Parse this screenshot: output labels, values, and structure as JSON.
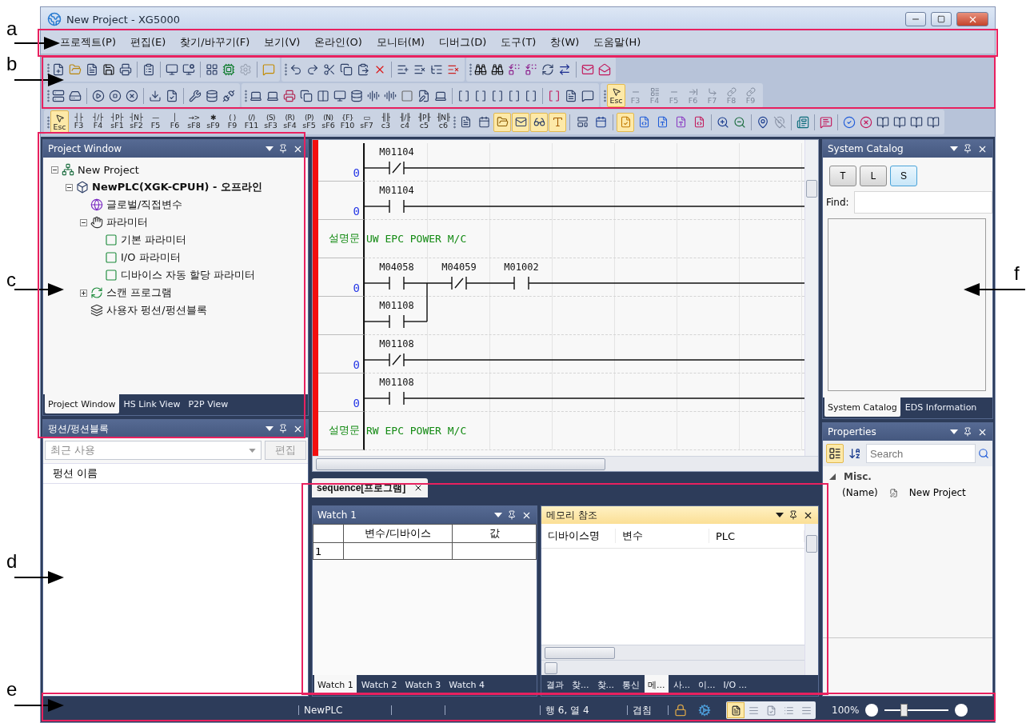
{
  "annotations": [
    {
      "label": "a"
    },
    {
      "label": "b"
    },
    {
      "label": "c"
    },
    {
      "label": "d"
    },
    {
      "label": "e"
    },
    {
      "label": "f"
    }
  ],
  "window": {
    "title": "New Project - XG5000"
  },
  "menu": [
    "프로젝트(P)",
    "편집(E)",
    "찾기/바꾸기(F)",
    "보기(V)",
    "온라인(O)",
    "모니터(M)",
    "디버그(D)",
    "도구(T)",
    "창(W)",
    "도움말(H)"
  ],
  "toolbar": {
    "edit_keys": [
      {
        "label": "Esc",
        "selected": true
      },
      {
        "label": "F3",
        "selected": false
      },
      {
        "label": "F4",
        "selected": false
      },
      {
        "label": "F5",
        "selected": false
      },
      {
        "label": "F6",
        "selected": false
      },
      {
        "label": "F7",
        "selected": false
      },
      {
        "label": "F8",
        "selected": false
      },
      {
        "label": "F9",
        "selected": false
      }
    ],
    "ladder_keys": [
      {
        "kind": "pointer",
        "label": "Esc",
        "selected": true
      },
      {
        "kind": "symbol",
        "symbol": "┤├",
        "label": "F3",
        "selected": false
      },
      {
        "kind": "symbol",
        "symbol": "┤/├",
        "label": "F4",
        "selected": false
      },
      {
        "kind": "symbol",
        "symbol": "┤P├",
        "label": "sF1",
        "selected": false
      },
      {
        "kind": "symbol",
        "symbol": "┤N├",
        "label": "sF2",
        "selected": false
      },
      {
        "kind": "symbol",
        "symbol": "—",
        "label": "F5",
        "selected": false
      },
      {
        "kind": "symbol",
        "symbol": "│",
        "label": "F6",
        "selected": false
      },
      {
        "kind": "symbol",
        "symbol": "→>",
        "label": "sF8",
        "selected": false
      },
      {
        "kind": "symbol",
        "symbol": "✱",
        "label": "sF9",
        "selected": false
      },
      {
        "kind": "symbol",
        "symbol": "( )",
        "label": "F9",
        "selected": false
      },
      {
        "kind": "symbol",
        "symbol": "(/)",
        "label": "F11",
        "selected": false
      },
      {
        "kind": "symbol",
        "symbol": "(S)",
        "label": "sF3",
        "selected": false
      },
      {
        "kind": "symbol",
        "symbol": "(R)",
        "label": "sF4",
        "selected": false
      },
      {
        "kind": "symbol",
        "symbol": "(P)",
        "label": "sF5",
        "selected": false
      },
      {
        "kind": "symbol",
        "symbol": "(N)",
        "label": "sF6",
        "selected": false
      },
      {
        "kind": "symbol",
        "symbol": "{F}",
        "label": "F10",
        "selected": false
      },
      {
        "kind": "symbol",
        "symbol": "▭",
        "label": "sF7",
        "selected": false
      },
      {
        "kind": "symbol",
        "symbol": "╢╟",
        "label": "c3",
        "selected": false
      },
      {
        "kind": "symbol",
        "symbol": "╢/╟",
        "label": "c4",
        "selected": false
      },
      {
        "kind": "symbol",
        "symbol": "╢P╟",
        "label": "c5",
        "selected": false
      },
      {
        "kind": "symbol",
        "symbol": "╢N╟",
        "label": "c6",
        "selected": false
      }
    ],
    "toggle_groups": [
      [
        {
          "selected": false
        },
        {
          "selected": false
        },
        {
          "selected": true
        },
        {
          "selected": true
        },
        {
          "selected": true
        },
        {
          "selected": true
        }
      ],
      [
        {
          "selected": false
        },
        {
          "selected": false
        }
      ],
      [
        {
          "selected": true
        },
        {
          "selected": false
        },
        {
          "selected": false
        },
        {
          "selected": false
        },
        {
          "selected": false
        }
      ]
    ]
  },
  "project_window": {
    "title": "Project Window",
    "tree": [
      {
        "label": "New Project",
        "kind": "project",
        "expanded": true,
        "children": [
          {
            "label": "NewPLC(XGK-CPUH) - 오프라인",
            "kind": "plc",
            "expanded": true,
            "children": [
              {
                "label": "글로벌/직접변수",
                "kind": "variables"
              },
              {
                "label": "파라미터",
                "kind": "parameter",
                "expanded": true,
                "children": [
                  {
                    "label": "기본 파라미터",
                    "kind": "param"
                  },
                  {
                    "label": "I/O 파라미터",
                    "kind": "param"
                  },
                  {
                    "label": "디바이스 자동 할당 파라미터",
                    "kind": "param"
                  }
                ]
              },
              {
                "label": "스캔 프로그램",
                "kind": "program",
                "expanded": false
              },
              {
                "label": "사용자 펑션/펑션블록",
                "kind": "function"
              }
            ]
          }
        ]
      }
    ],
    "tabs": [
      {
        "label": "Project Window",
        "selected": true
      },
      {
        "label": "HS Link View",
        "selected": false
      },
      {
        "label": "P2P View",
        "selected": false
      }
    ]
  },
  "function_panel": {
    "title": "펑션/펑션블록",
    "combo_placeholder": "최근 사용",
    "edit_button": "편집",
    "edit_disabled": true,
    "column": "펑션 이름"
  },
  "ladder": {
    "rungs": [
      {
        "kind": "rung",
        "step": "0",
        "contacts": [
          {
            "device": "M01104",
            "kind": "nc"
          }
        ]
      },
      {
        "kind": "rung",
        "step": "0",
        "contacts": [
          {
            "device": "M01104",
            "kind": "no"
          }
        ]
      },
      {
        "kind": "comment",
        "label": "설명문",
        "text": "UW EPC POWER M/C"
      },
      {
        "kind": "rung",
        "step": "0",
        "contacts": [
          {
            "device": "M04058",
            "kind": "no"
          },
          {
            "device": "M04059",
            "kind": "nc"
          },
          {
            "device": "M01002",
            "kind": "no"
          }
        ],
        "branch": [
          {
            "device": "M01108",
            "kind": "no"
          }
        ]
      },
      {
        "kind": "rung",
        "step": "0",
        "contacts": [
          {
            "device": "M01108",
            "kind": "nc"
          }
        ]
      },
      {
        "kind": "rung",
        "step": "0",
        "contacts": [
          {
            "device": "M01108",
            "kind": "no"
          }
        ]
      },
      {
        "kind": "comment",
        "label": "설명문",
        "text": "RW EPC POWER M/C"
      }
    ]
  },
  "document_tabs": [
    {
      "label": "sequence[프로그램]",
      "selected": true
    }
  ],
  "watch": {
    "title": "Watch 1",
    "active": false,
    "columns": [
      "변수/디바이스",
      "값"
    ],
    "rows": [
      "1"
    ],
    "tabs": [
      {
        "label": "Watch 1",
        "selected": true
      },
      {
        "label": "Watch 2",
        "selected": false
      },
      {
        "label": "Watch 3",
        "selected": false
      },
      {
        "label": "Watch 4",
        "selected": false
      }
    ]
  },
  "memory": {
    "title": "메모리 참조",
    "active": true,
    "columns": [
      "디바이스명",
      "변수",
      "PLC"
    ],
    "tabs": [
      {
        "label": "결과",
        "selected": false
      },
      {
        "label": "찾...",
        "selected": false
      },
      {
        "label": "찾...",
        "selected": false
      },
      {
        "label": "통신",
        "selected": false
      },
      {
        "label": "메...",
        "selected": true
      },
      {
        "label": "사...",
        "selected": false
      },
      {
        "label": "이...",
        "selected": false
      },
      {
        "label": "I/O ...",
        "selected": false
      }
    ]
  },
  "catalog": {
    "title": "System Catalog",
    "buttons": [
      {
        "label": "T",
        "selected": false
      },
      {
        "label": "L",
        "selected": false
      },
      {
        "label": "S",
        "selected": true
      }
    ],
    "find_label": "Find:",
    "tabs": [
      {
        "label": "System Catalog",
        "selected": true
      },
      {
        "label": "EDS Information",
        "selected": false
      }
    ]
  },
  "properties": {
    "title": "Properties",
    "view_buttons": [
      {
        "kind": "categorized",
        "selected": true
      },
      {
        "kind": "alphabetical",
        "selected": false
      }
    ],
    "search_placeholder": "Search",
    "groups": [
      {
        "label": "Misc.",
        "expanded": true,
        "rows": [
          {
            "name": "(Name)",
            "value": "New Project"
          }
        ]
      }
    ]
  },
  "status_bar": {
    "plc": "NewPLC",
    "position": "행 6, 열 4",
    "mode": "겹침",
    "view_buttons": [
      {
        "selected": true
      },
      {
        "selected": false
      },
      {
        "selected": false
      },
      {
        "selected": false
      },
      {
        "selected": false
      }
    ],
    "zoom": "100%",
    "zoom_slider": {
      "level": 0.3
    }
  }
}
